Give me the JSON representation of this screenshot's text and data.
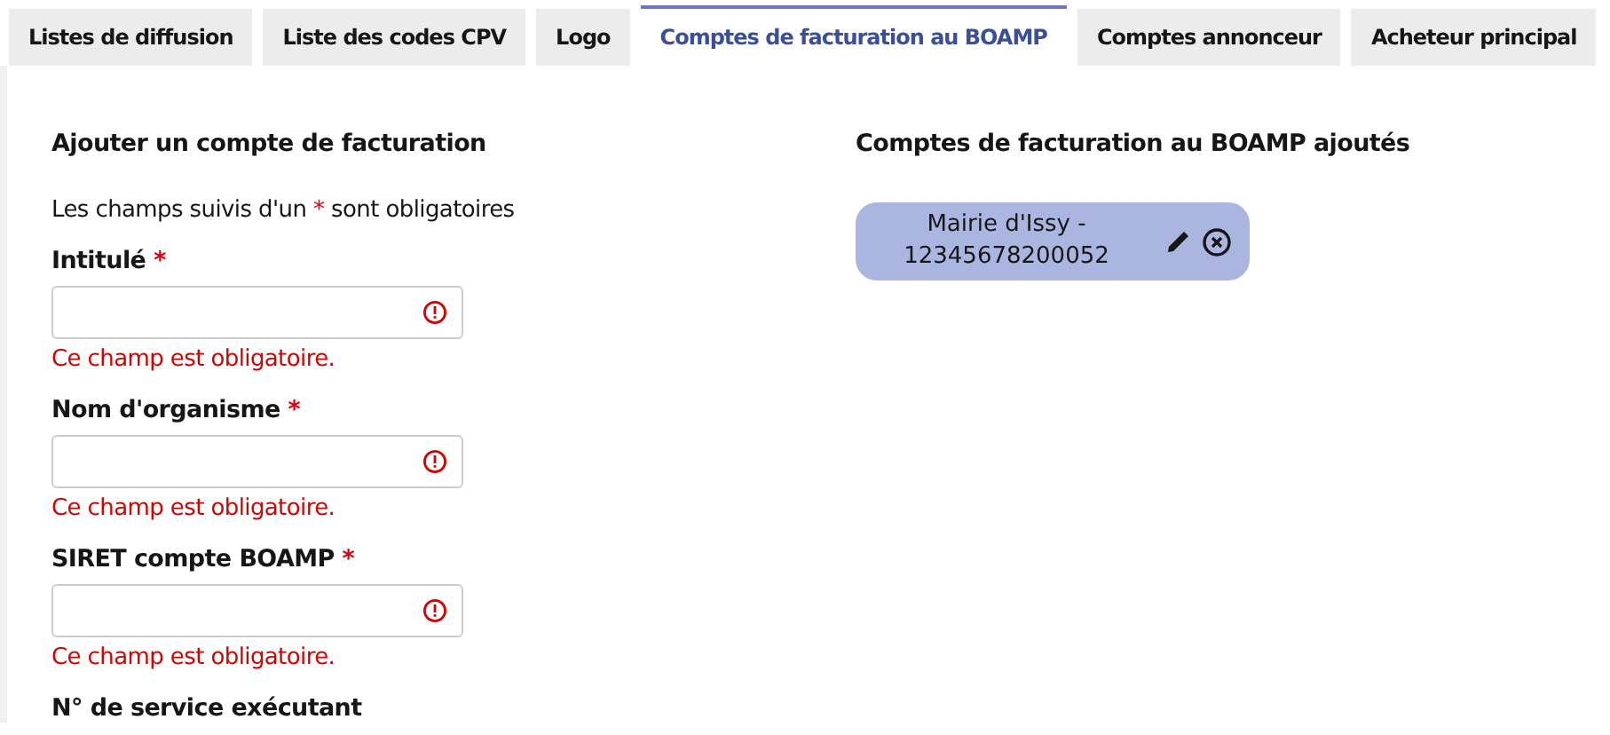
{
  "tabs": [
    {
      "label": "Listes de diffusion",
      "selected": false
    },
    {
      "label": "Liste des codes CPV",
      "selected": false
    },
    {
      "label": "Logo",
      "selected": false
    },
    {
      "label": "Comptes de facturation au BOAMP",
      "selected": true
    },
    {
      "label": "Comptes annonceur",
      "selected": false
    },
    {
      "label": "Acheteur principal",
      "selected": false
    }
  ],
  "form": {
    "title": "Ajouter un compte de facturation",
    "note": {
      "before": "Les champs suivis d'un",
      "mark": "*",
      "after": "sont obligatoires"
    },
    "fields": [
      {
        "label": "Intitulé",
        "required": true,
        "invalid": true,
        "error": "Ce champ est obligatoire."
      },
      {
        "label": "Nom d'organisme",
        "required": true,
        "invalid": true,
        "error": "Ce champ est obligatoire."
      },
      {
        "label": "SIRET compte BOAMP",
        "required": true,
        "invalid": true,
        "error": "Ce champ est obligatoire."
      },
      {
        "label": "N° de service exécutant",
        "required": false
      }
    ]
  },
  "accounts": {
    "title": "Comptes de facturation au BOAMP ajoutés",
    "items": [
      {
        "lines": [
          "Mairie d'Issy -",
          "12345678200052"
        ]
      }
    ]
  }
}
